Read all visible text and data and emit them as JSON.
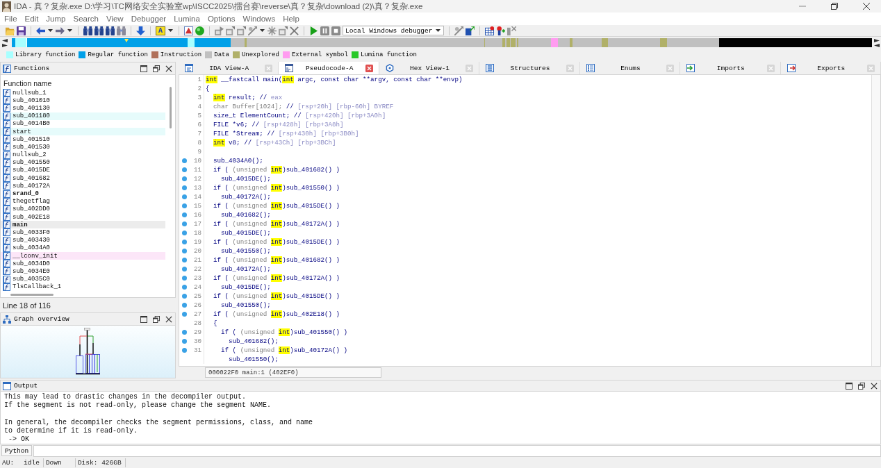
{
  "window": {
    "title": "IDA - 真？复杂.exe D:\\学习\\TC网络安全实验室wp\\ISCC2025\\擂台赛\\reverse\\真？复杂\\download (2)\\真？复杂.exe"
  },
  "menu": [
    "File",
    "Edit",
    "Jump",
    "Search",
    "View",
    "Debugger",
    "Lumina",
    "Options",
    "Windows",
    "Help"
  ],
  "toolbar": {
    "letter_button": "A",
    "debugger": "Local Windows debugger"
  },
  "legend": [
    {
      "label": "Library function",
      "color": "#a8ffff"
    },
    {
      "label": "Regular function",
      "color": "#00a0e8"
    },
    {
      "label": "Instruction",
      "color": "#b0705a"
    },
    {
      "label": "Data",
      "color": "#c0c0c0"
    },
    {
      "label": "Unexplored",
      "color": "#b0b068"
    },
    {
      "label": "External symbol",
      "color": "#ff9cf0"
    },
    {
      "label": "Lumina function",
      "color": "#28c828"
    }
  ],
  "functions": {
    "title": "Functions",
    "column": "Function name",
    "items": [
      {
        "name": "nullsub_1",
        "selected": false,
        "bold": false
      },
      {
        "name": "sub_401010",
        "selected": false,
        "bold": false
      },
      {
        "name": "sub_401130",
        "selected": false,
        "bold": false
      },
      {
        "name": "sub_401180",
        "selected": false,
        "bold": false,
        "color": "#e6fbfb"
      },
      {
        "name": "sub_4014B0",
        "selected": false,
        "bold": false
      },
      {
        "name": "start",
        "selected": false,
        "bold": false,
        "color": "#e6fbfb"
      },
      {
        "name": "sub_401510",
        "selected": false,
        "bold": false
      },
      {
        "name": "sub_401530",
        "selected": false,
        "bold": false
      },
      {
        "name": "nullsub_2",
        "selected": false,
        "bold": false
      },
      {
        "name": "sub_401550",
        "selected": false,
        "bold": false
      },
      {
        "name": "sub_4015DE",
        "selected": false,
        "bold": false
      },
      {
        "name": "sub_401682",
        "selected": false,
        "bold": false
      },
      {
        "name": "sub_40172A",
        "selected": false,
        "bold": false
      },
      {
        "name": "srand_0",
        "selected": false,
        "bold": true
      },
      {
        "name": "thegetflag",
        "selected": false,
        "bold": false
      },
      {
        "name": "sub_402DD0",
        "selected": false,
        "bold": false
      },
      {
        "name": "sub_402E18",
        "selected": false,
        "bold": false
      },
      {
        "name": "main",
        "selected": true,
        "bold": true
      },
      {
        "name": "sub_4033F0",
        "selected": false,
        "bold": false
      },
      {
        "name": "sub_403430",
        "selected": false,
        "bold": false
      },
      {
        "name": "sub_4034A0",
        "selected": false,
        "bold": false
      },
      {
        "name": "__lconv_init",
        "selected": false,
        "bold": false,
        "color": "#fce6f8"
      },
      {
        "name": "sub_4034D0",
        "selected": false,
        "bold": false
      },
      {
        "name": "sub_4034E0",
        "selected": false,
        "bold": false
      },
      {
        "name": "sub_4035C0",
        "selected": false,
        "bold": false
      },
      {
        "name": "TlsCallback_1",
        "selected": false,
        "bold": false
      }
    ],
    "status": "Line 18 of 116"
  },
  "graph_overview": {
    "title": "Graph overview"
  },
  "tabs": [
    {
      "label": "IDA View-A",
      "kind": "disassembly",
      "selected": false
    },
    {
      "label": "Pseudocode-A",
      "kind": "pseudocode",
      "selected": true
    },
    {
      "label": "Hex View-1",
      "kind": "hex",
      "selected": false
    },
    {
      "label": "Structures",
      "kind": "structures",
      "selected": false
    },
    {
      "label": "Enums",
      "kind": "enums",
      "selected": false
    },
    {
      "label": "Imports",
      "kind": "imports",
      "selected": false
    },
    {
      "label": "Exports",
      "kind": "exports",
      "selected": false
    }
  ],
  "code": {
    "lines": [
      {
        "number": "1",
        "marked": false,
        "segments": [
          {
            "kind": "highlight",
            "text": "int"
          },
          {
            "kind": "code",
            "text": " __fastcall main("
          },
          {
            "kind": "highlight",
            "text": "int"
          },
          {
            "kind": "code",
            "text": " argc, const char **argv, const char **envp)"
          }
        ]
      },
      {
        "number": "2",
        "marked": false,
        "segments": [
          {
            "kind": "code",
            "text": "{"
          }
        ]
      },
      {
        "number": "3",
        "marked": false,
        "segments": [
          {
            "kind": "highlight",
            "text": "  int"
          },
          {
            "kind": "code",
            "text": " result; // "
          },
          {
            "kind": "comment",
            "text": "eax"
          }
        ]
      },
      {
        "number": "4",
        "marked": false,
        "segments": [
          {
            "kind": "dim",
            "text": "  char Buffer[1024]; "
          },
          {
            "kind": "code",
            "text": "// "
          },
          {
            "kind": "comment",
            "text": "[rsp+20h] [rbp-60h] BYREF"
          }
        ]
      },
      {
        "number": "5",
        "marked": false,
        "segments": [
          {
            "kind": "code",
            "text": "  size_t ElementCount; // "
          },
          {
            "kind": "comment",
            "text": "[rsp+420h] [rbp+3A0h]"
          }
        ]
      },
      {
        "number": "6",
        "marked": false,
        "segments": [
          {
            "kind": "code",
            "text": "  FILE *v6; // "
          },
          {
            "kind": "comment",
            "text": "[rsp+428h] [rbp+3A8h]"
          }
        ]
      },
      {
        "number": "7",
        "marked": false,
        "segments": [
          {
            "kind": "code",
            "text": "  FILE *Stream; // "
          },
          {
            "kind": "comment",
            "text": "[rsp+430h] [rbp+3B0h]"
          }
        ]
      },
      {
        "number": "8",
        "marked": false,
        "segments": [
          {
            "kind": "highlight",
            "text": "  int"
          },
          {
            "kind": "code",
            "text": " v8; // "
          },
          {
            "kind": "comment",
            "text": "[rsp+43Ch] [rbp+3BCh]"
          }
        ]
      },
      {
        "number": "9",
        "marked": false
      },
      {
        "number": "10",
        "marked": true,
        "segments": [
          {
            "kind": "code",
            "text": "  sub_4034A0();"
          }
        ]
      },
      {
        "number": "11",
        "marked": true,
        "segments": [
          {
            "kind": "code",
            "text": "  if ( "
          },
          {
            "kind": "dim",
            "text": "(unsigned "
          },
          {
            "kind": "highlight",
            "text": "int"
          },
          {
            "kind": "code",
            "text": ")sub_401682() )"
          }
        ]
      },
      {
        "number": "12",
        "marked": true,
        "segments": [
          {
            "kind": "code",
            "text": "    sub_4015DE();"
          }
        ]
      },
      {
        "number": "13",
        "marked": true,
        "segments": [
          {
            "kind": "code",
            "text": "  if ( "
          },
          {
            "kind": "dim",
            "text": "(unsigned "
          },
          {
            "kind": "highlight",
            "text": "int"
          },
          {
            "kind": "code",
            "text": ")sub_401550() )"
          }
        ]
      },
      {
        "number": "14",
        "marked": true,
        "segments": [
          {
            "kind": "code",
            "text": "    sub_40172A();"
          }
        ]
      },
      {
        "number": "15",
        "marked": true,
        "segments": [
          {
            "kind": "code",
            "text": "  if ( "
          },
          {
            "kind": "dim",
            "text": "(unsigned "
          },
          {
            "kind": "highlight",
            "text": "int"
          },
          {
            "kind": "code",
            "text": ")sub_4015DE() )"
          }
        ]
      },
      {
        "number": "16",
        "marked": true,
        "segments": [
          {
            "kind": "code",
            "text": "    sub_401682();"
          }
        ]
      },
      {
        "number": "17",
        "marked": true,
        "segments": [
          {
            "kind": "code",
            "text": "  if ( "
          },
          {
            "kind": "dim",
            "text": "(unsigned "
          },
          {
            "kind": "highlight",
            "text": "int"
          },
          {
            "kind": "code",
            "text": ")sub_40172A() )"
          }
        ]
      },
      {
        "number": "18",
        "marked": true,
        "segments": [
          {
            "kind": "code",
            "text": "    sub_4015DE();"
          }
        ]
      },
      {
        "number": "19",
        "marked": true,
        "segments": [
          {
            "kind": "code",
            "text": "  if ( "
          },
          {
            "kind": "dim",
            "text": "(unsigned "
          },
          {
            "kind": "highlight",
            "text": "int"
          },
          {
            "kind": "code",
            "text": ")sub_4015DE() )"
          }
        ]
      },
      {
        "number": "20",
        "marked": true,
        "segments": [
          {
            "kind": "code",
            "text": "    sub_401550();"
          }
        ]
      },
      {
        "number": "21",
        "marked": true,
        "segments": [
          {
            "kind": "code",
            "text": "  if ( "
          },
          {
            "kind": "dim",
            "text": "(unsigned "
          },
          {
            "kind": "highlight",
            "text": "int"
          },
          {
            "kind": "code",
            "text": ")sub_401682() )"
          }
        ]
      },
      {
        "number": "22",
        "marked": true,
        "segments": [
          {
            "kind": "code",
            "text": "    sub_40172A();"
          }
        ]
      },
      {
        "number": "23",
        "marked": true,
        "segments": [
          {
            "kind": "code",
            "text": "  if ( "
          },
          {
            "kind": "dim",
            "text": "(unsigned "
          },
          {
            "kind": "highlight",
            "text": "int"
          },
          {
            "kind": "code",
            "text": ")sub_40172A() )"
          }
        ]
      },
      {
        "number": "24",
        "marked": true,
        "segments": [
          {
            "kind": "code",
            "text": "    sub_4015DE();"
          }
        ]
      },
      {
        "number": "25",
        "marked": true,
        "segments": [
          {
            "kind": "code",
            "text": "  if ( "
          },
          {
            "kind": "dim",
            "text": "(unsigned "
          },
          {
            "kind": "highlight",
            "text": "int"
          },
          {
            "kind": "code",
            "text": ")sub_4015DE() )"
          }
        ]
      },
      {
        "number": "26",
        "marked": true,
        "segments": [
          {
            "kind": "code",
            "text": "    sub_401550();"
          }
        ]
      },
      {
        "number": "27",
        "marked": true,
        "segments": [
          {
            "kind": "code",
            "text": "  if ( "
          },
          {
            "kind": "dim",
            "text": "(unsigned "
          },
          {
            "kind": "highlight",
            "text": "int"
          },
          {
            "kind": "code",
            "text": ")sub_402E18() )"
          }
        ]
      },
      {
        "number": "28",
        "marked": false,
        "segments": [
          {
            "kind": "code",
            "text": "  {"
          }
        ]
      },
      {
        "number": "29",
        "marked": true,
        "segments": [
          {
            "kind": "code",
            "text": "    if ( "
          },
          {
            "kind": "dim",
            "text": "(unsigned "
          },
          {
            "kind": "highlight",
            "text": "int"
          },
          {
            "kind": "code",
            "text": ")sub_401550() )"
          }
        ]
      },
      {
        "number": "30",
        "marked": true,
        "segments": [
          {
            "kind": "code",
            "text": "      sub_401682();"
          }
        ]
      },
      {
        "number": "31",
        "marked": true,
        "segments": [
          {
            "kind": "code",
            "text": "    if ( "
          },
          {
            "kind": "dim",
            "text": "(unsigned "
          },
          {
            "kind": "highlight",
            "text": "int"
          },
          {
            "kind": "code",
            "text": ")sub_40172A() )"
          }
        ]
      },
      {
        "marked": false,
        "segments": [
          {
            "kind": "code",
            "text": "      sub_401550();"
          }
        ]
      }
    ],
    "status": "000022F0 main:1 (402EF0)"
  },
  "output": {
    "title": "Output",
    "paragraphs": [
      [
        "This may lead to drastic changes in the decompiler output.",
        "If the segment is not read-only, please change the segment NAME."
      ],
      [
        "In general, the decompiler checks the segment permissions, class, and name",
        "to determine if it is read-only.",
        " -> OK"
      ]
    ]
  },
  "python": {
    "label": "Python"
  },
  "status_bar": [
    [
      "AU:",
      "idle"
    ],
    [
      "Down"
    ],
    [
      "Disk: 426GB"
    ]
  ]
}
